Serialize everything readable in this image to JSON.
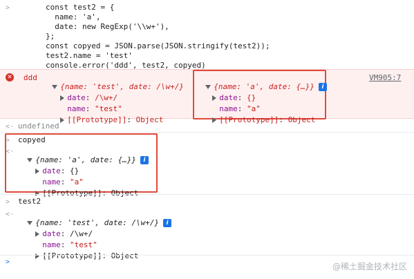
{
  "code": {
    "lines": [
      "const test2 = {",
      "  name: 'a',",
      "  date: new RegExp('\\\\w+'),",
      "};",
      "const copyed = JSON.parse(JSON.stringify(test2));",
      "test2.name = 'test'",
      "console.error('ddd', test2, copyed)"
    ]
  },
  "error_row": {
    "label": "ddd",
    "obj1_summary": "{name: 'test', date: /\\w+/}",
    "obj1_props": [
      {
        "key": "date",
        "value": "/\\w+/",
        "expandable": true
      },
      {
        "key": "name",
        "value": "\"test\"",
        "expandable": false
      },
      {
        "key": "[[Prototype]]",
        "value": "Object",
        "expandable": true
      }
    ],
    "obj2_summary": "{name: 'a', date: {…}}",
    "obj2_props": [
      {
        "key": "date",
        "value": "{}",
        "expandable": true
      },
      {
        "key": "name",
        "value": "\"a\"",
        "expandable": false
      },
      {
        "key": "[[Prototype]]",
        "value": "Object",
        "expandable": true
      }
    ],
    "source_link": "VM905:7"
  },
  "undefined_text": "undefined",
  "copyed_block": {
    "input": "copyed",
    "summary": "{name: 'a', date: {…}}",
    "props": [
      {
        "key": "date",
        "value": "{}"
      },
      {
        "key": "name",
        "value": "\"a\""
      },
      {
        "key": "[[Prototype]]",
        "value": "Object"
      }
    ]
  },
  "test2_block": {
    "input": "test2",
    "summary": "{name: 'test', date: /\\w+/}",
    "props": [
      {
        "key": "date",
        "value": "/\\w+/"
      },
      {
        "key": "name",
        "value": "\"test\""
      },
      {
        "key": "[[Prototype]]",
        "value": "Object"
      }
    ]
  },
  "watermark": "@稀土掘金技术社区",
  "colors": {
    "error_bg": "#fff0f0",
    "highlight_box": "#e0483a",
    "property_key": "#881391",
    "string_value": "#c41a16",
    "info_icon": "#1a73e8"
  }
}
